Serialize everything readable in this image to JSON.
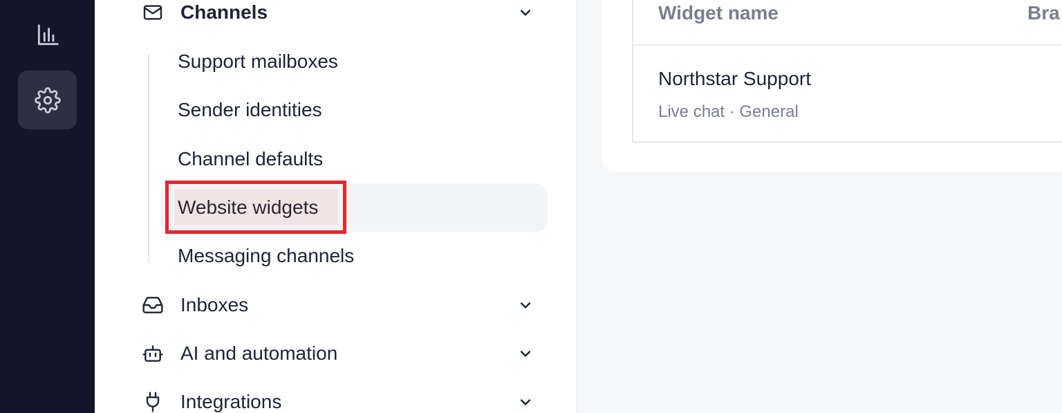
{
  "rail": {
    "items": [
      {
        "icon": "bar-chart-icon"
      },
      {
        "icon": "gear-icon",
        "active": true
      }
    ]
  },
  "nav": {
    "sections": [
      {
        "label": "Channels",
        "icon": "mail-icon",
        "expanded": true
      },
      {
        "label": "Inboxes",
        "icon": "inbox-icon",
        "expanded": false
      },
      {
        "label": "AI and automation",
        "icon": "bot-icon",
        "expanded": false
      },
      {
        "label": "Integrations",
        "icon": "plug-icon",
        "expanded": false
      }
    ],
    "channel_items": [
      "Support mailboxes",
      "Sender identities",
      "Channel defaults",
      "Website widgets",
      "Messaging channels"
    ],
    "selected_item": "Website widgets"
  },
  "table": {
    "headers": [
      "Widget name",
      "Bra"
    ],
    "rows": [
      {
        "name": "Northstar Support",
        "meta": "Live chat · General"
      }
    ]
  },
  "colors": {
    "rail_bg": "#111629",
    "highlight": "#e3262d"
  }
}
